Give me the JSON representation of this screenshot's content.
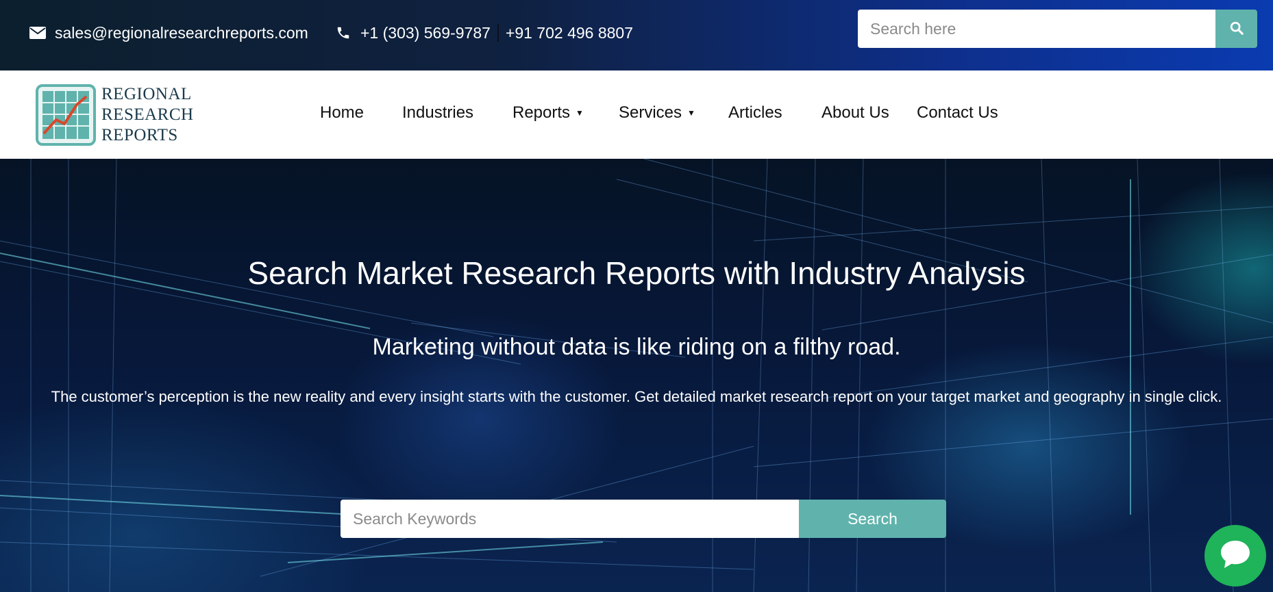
{
  "topbar": {
    "email": "sales@regionalresearchreports.com",
    "phone_us": "+1 (303) 569-9787",
    "phone_in": "+91 702 496 8807",
    "search_placeholder": "Search here",
    "icons": [
      "envelope-icon",
      "phone-icon",
      "search-icon"
    ]
  },
  "logo": {
    "line1": "REGIONAL",
    "line2": "RESEARCH",
    "line3": "REPORTS"
  },
  "nav": {
    "items": [
      {
        "label": "Home",
        "dropdown": false
      },
      {
        "label": "Industries",
        "dropdown": false
      },
      {
        "label": "Reports",
        "dropdown": true
      },
      {
        "label": "Services",
        "dropdown": true
      },
      {
        "label": "Articles",
        "dropdown": false
      },
      {
        "label": "About Us",
        "dropdown": false
      },
      {
        "label": "Contact Us",
        "dropdown": false
      }
    ],
    "caret": "▼"
  },
  "hero": {
    "title": "Search Market Research Reports with Industry Analysis",
    "tagline": "Marketing without data is like riding on a filthy road.",
    "description": "The customer’s perception is the new reality and every insight starts with the customer. Get detailed market research report on your target market and geography in single click.",
    "search_placeholder": "Search Keywords",
    "search_button": "Search"
  },
  "chat": {
    "icon": "chat-bubble-icon"
  },
  "colors": {
    "accent": "#5fb3ac",
    "chat": "#1fb35a",
    "topbar_dark": "#0c1f2e",
    "topbar_blue": "#0a3bb0"
  }
}
